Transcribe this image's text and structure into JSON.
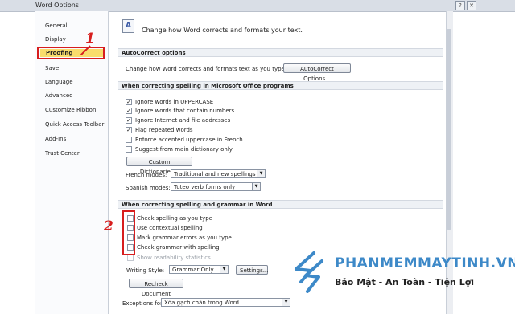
{
  "window": {
    "title": "Word Options"
  },
  "nav": {
    "items": [
      {
        "label": "General"
      },
      {
        "label": "Display"
      },
      {
        "label": "Proofing"
      },
      {
        "label": "Save"
      },
      {
        "label": "Language"
      },
      {
        "label": "Advanced"
      },
      {
        "label": "Customize Ribbon"
      },
      {
        "label": "Quick Access Toolbar"
      },
      {
        "label": "Add-Ins"
      },
      {
        "label": "Trust Center"
      }
    ],
    "selected": "Proofing"
  },
  "header": {
    "text": "Change how Word corrects and formats your text."
  },
  "autocorrect": {
    "section": "AutoCorrect options",
    "label": "Change how Word corrects and formats text as you type:",
    "button": "AutoCorrect Options..."
  },
  "office_spelling": {
    "section": "When correcting spelling in Microsoft Office programs",
    "options": [
      {
        "label": "Ignore words in UPPERCASE",
        "checked": true
      },
      {
        "label": "Ignore words that contain numbers",
        "checked": true
      },
      {
        "label": "Ignore Internet and file addresses",
        "checked": true
      },
      {
        "label": "Flag repeated words",
        "checked": true
      },
      {
        "label": "Enforce accented uppercase in French",
        "checked": false
      },
      {
        "label": "Suggest from main dictionary only",
        "checked": false
      }
    ],
    "custom_dictionaries_button": "Custom Dictionaries...",
    "french_modes": {
      "label": "French modes:",
      "value": "Traditional and new spellings"
    },
    "spanish_modes": {
      "label": "Spanish modes:",
      "value": "Tuteo verb forms only"
    }
  },
  "word_spelling": {
    "section": "When correcting spelling and grammar in Word",
    "options": [
      {
        "label": "Check spelling as you type",
        "checked": false
      },
      {
        "label": "Use contextual spelling",
        "checked": false
      },
      {
        "label": "Mark grammar errors as you type",
        "checked": false
      },
      {
        "label": "Check grammar with spelling",
        "checked": false
      },
      {
        "label": "Show readability statistics",
        "checked": false,
        "disabled": true
      }
    ],
    "writing_style": {
      "label": "Writing Style:",
      "value": "Grammar Only"
    },
    "settings_button": "Settings...",
    "recheck_button": "Recheck Document"
  },
  "exceptions": {
    "label": "Exceptions for:",
    "value": "Xóa gạch chân trong Word"
  },
  "annotations": {
    "step1": "1",
    "step2": "2"
  },
  "watermark": {
    "title": "PHANMEMMAYTINH.VN",
    "tagline": "Bảo Mật - An Toàn - Tiện Lợi",
    "color": "#3d89c8"
  },
  "colors": {
    "highlight": "#f9dc6b",
    "annotation": "#d71e1e"
  }
}
